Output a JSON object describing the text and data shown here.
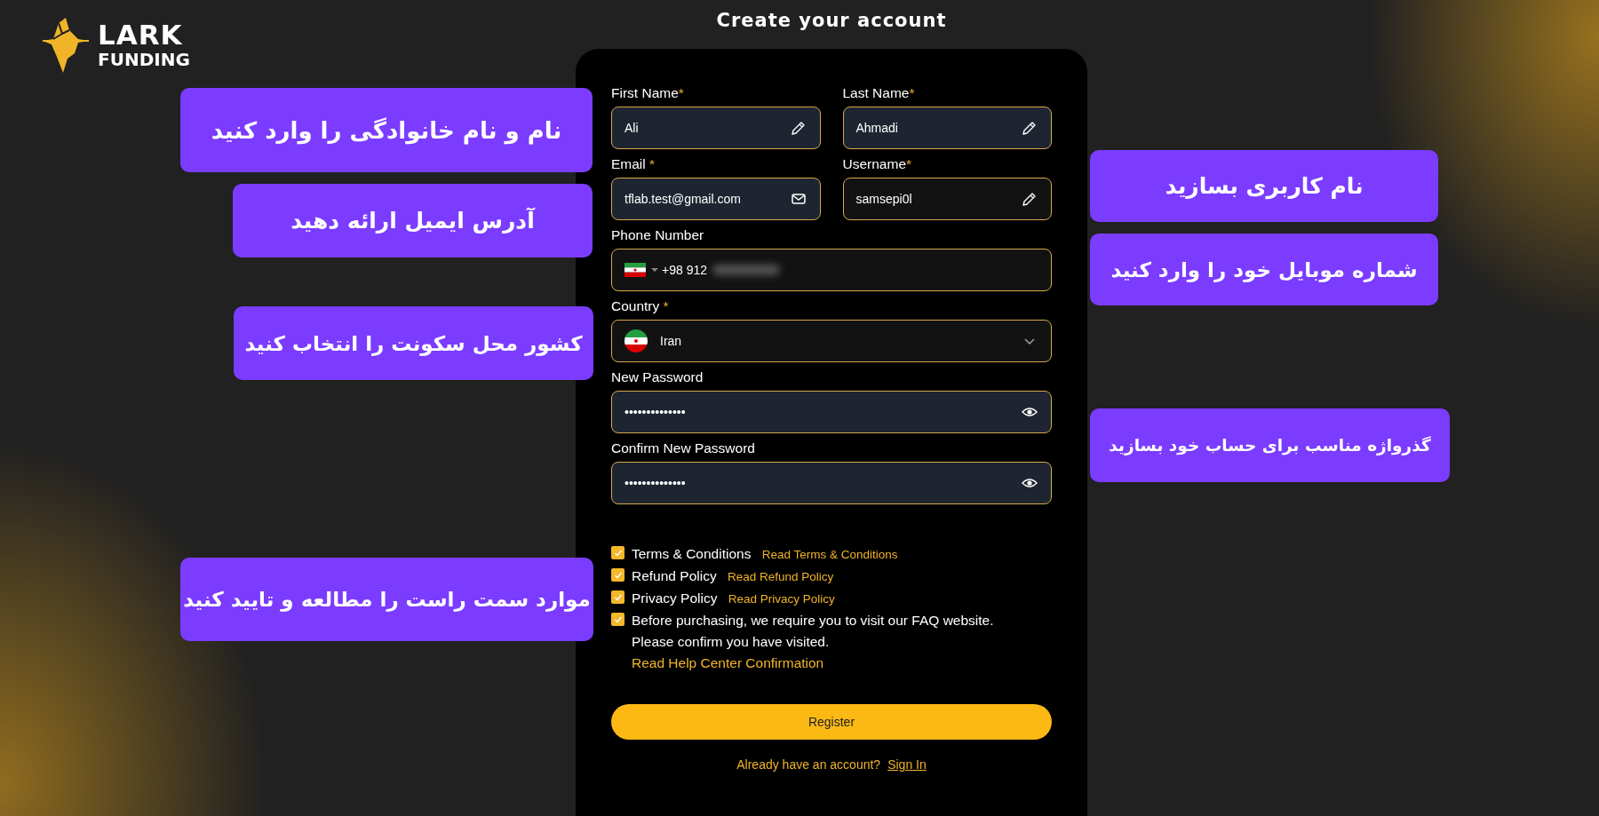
{
  "logo": {
    "word": "LARK",
    "subword": "FUNDING"
  },
  "title": "Create your account",
  "form": {
    "rows": [
      [
        {
          "kind": "text",
          "label": "First Name",
          "required_mark": "*",
          "value": "Ali",
          "autofilled": true
        },
        {
          "kind": "text",
          "label": "Last Name",
          "required_mark": "*",
          "value": "Ahmadi",
          "autofilled": true
        }
      ],
      [
        {
          "kind": "email",
          "label": "Email",
          "required_mark": " *",
          "value": "tflab.test@gmail.com",
          "autofilled": true
        },
        {
          "kind": "text",
          "label": "Username",
          "required_mark": "*",
          "value": "samsepi0l",
          "autofilled": false
        }
      ],
      [
        {
          "kind": "phone",
          "label": "Phone Number",
          "value": "+98 912",
          "redacted": true,
          "autofilled": false
        }
      ],
      [
        {
          "kind": "select",
          "label": "Country",
          "required_mark": " *",
          "value": "Iran",
          "autofilled": false
        }
      ],
      [
        {
          "kind": "password",
          "label": "New Password",
          "value": "••••••••••••••",
          "autofilled": true
        }
      ],
      [
        {
          "kind": "password",
          "label": "Confirm New Password",
          "value": "••••••••••••••",
          "autofilled": true
        }
      ]
    ],
    "agreements": [
      {
        "label": "Terms & Conditions",
        "link": "Read Terms & Conditions",
        "checked": true
      },
      {
        "label": "Refund Policy",
        "link": "Read Refund Policy",
        "checked": true
      },
      {
        "label": "Privacy Policy",
        "link": "Read Privacy Policy",
        "checked": true
      },
      {
        "label": "Before purchasing, we require you to visit our FAQ website. Please confirm you have visited.",
        "link": "Read Help Center Confirmation",
        "checked": true
      }
    ],
    "submit": "Register",
    "footer": {
      "text": "Already have an account?",
      "link": "Sign In"
    }
  },
  "callouts": [
    {
      "text": "نام و نام خانوادگی را وارد کنید"
    },
    {
      "text": "آدرس ایمیل ارائه دهید"
    },
    {
      "text": "کشور محل سکونت را انتخاب کنید"
    },
    {
      "text": "موارد سمت راست را مطالعه و تایید کنید"
    },
    {
      "text": "نام کاربری بسازید"
    },
    {
      "text": "شماره موبایل خود را وارد کنید"
    },
    {
      "text": "گذرواژه مناسب برای حساب خود بسازید"
    }
  ]
}
